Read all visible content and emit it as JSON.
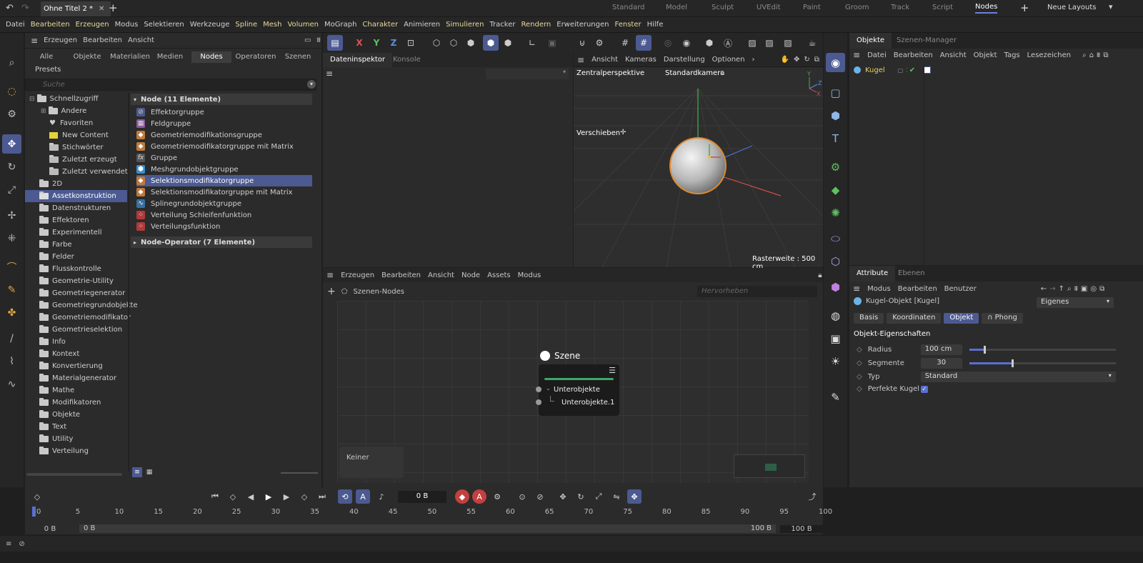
{
  "top": {
    "doc_tab": "Ohne Titel 2 *",
    "layouts": [
      "Standard",
      "Model",
      "Sculpt",
      "UVEdit",
      "Paint",
      "Groom",
      "Track",
      "Script",
      "Nodes"
    ],
    "new_layouts": "Neue Layouts"
  },
  "menu": [
    "Datei",
    "Bearbeiten",
    "Erzeugen",
    "Modus",
    "Selektieren",
    "Werkzeuge",
    "Spline",
    "Mesh",
    "Volumen",
    "MoGraph",
    "Charakter",
    "Animieren",
    "Simulieren",
    "Tracker",
    "Rendern",
    "Erweiterungen",
    "Fenster",
    "Hilfe"
  ],
  "asset": {
    "menu": [
      "Erzeugen",
      "Bearbeiten",
      "Ansicht"
    ],
    "tabs": [
      "Alle",
      "Objekte",
      "Materialien",
      "Medien",
      "Nodes",
      "Operatoren",
      "Szenen"
    ],
    "presets": "Presets",
    "search_placeholder": "Suche",
    "tree": [
      "Schnellzugriff",
      "Andere",
      "Favoriten",
      "New Content",
      "Stichwörter",
      "Zuletzt erzeugt",
      "Zuletzt verwendet",
      "2D",
      "Assetkonstruktion",
      "Datenstrukturen",
      "Effektoren",
      "Experimentell",
      "Farbe",
      "Felder",
      "Flusskontrolle",
      "Geometrie-Utility",
      "Geometriegenerator",
      "Geometriegrundobjekte",
      "Geometriemodifikator",
      "Geometrieselektion",
      "Info",
      "Kontext",
      "Konvertierung",
      "Materialgenerator",
      "Mathe",
      "Modifikatoren",
      "Objekte",
      "Text",
      "Utility",
      "Verteilung"
    ],
    "group1": "Node (11 Elemente)",
    "nodes": [
      "Effektorgruppe",
      "Feldgruppe",
      "Geometriemodifikationsgruppe",
      "Geometriemodifikatorgruppe mit Matrix",
      "Gruppe",
      "Meshgrundobjektgruppe",
      "Selektionsmodifikatorgruppe",
      "Selektionsmodifikatorgruppe mit Matrix",
      "Splinegrundobjektgruppe",
      "Verteilung Schleifenfunktion",
      "Verteilungsfunktion"
    ],
    "group2": "Node-Operator (7 Elemente)"
  },
  "inspector": {
    "tab1": "Dateninspektor",
    "tab2": "Konsole"
  },
  "viewport": {
    "menu": [
      "Ansicht",
      "Kameras",
      "Darstellung",
      "Optionen"
    ],
    "perspective": "Zentralperspektive",
    "camera": "Standardkamera",
    "tool": "Verschieben",
    "grid": "Rasterweite : 500 cm"
  },
  "nodeeditor": {
    "menu": [
      "Erzeugen",
      "Bearbeiten",
      "Ansicht",
      "Node",
      "Assets",
      "Modus"
    ],
    "path": "Szenen-Nodes",
    "search_placeholder": "Hervorheben",
    "node_title": "Szene",
    "port1": "Unterobjekte",
    "port2": "Unterobjekte.1",
    "info": "Keiner"
  },
  "objects": {
    "tab1": "Objekte",
    "tab2": "Szenen-Manager",
    "menu": [
      "Datei",
      "Bearbeiten",
      "Ansicht",
      "Objekt",
      "Tags",
      "Lesezeichen"
    ],
    "item": "Kugel"
  },
  "attributes": {
    "tab1": "Attribute",
    "tab2": "Ebenen",
    "menu": [
      "Modus",
      "Bearbeiten",
      "Benutzer"
    ],
    "object_name": "Kugel-Objekt [Kugel]",
    "dropdown": "Eigenes",
    "subtabs": [
      "Basis",
      "Koordinaten",
      "Objekt",
      "Phong"
    ],
    "section": "Objekt-Eigenschaften",
    "radius_label": "Radius",
    "radius_value": "100 cm",
    "radius_level": 0.1,
    "segments_label": "Segmente",
    "segments_value": "30",
    "segments_level": 0.29,
    "type_label": "Typ",
    "type_value": "Standard",
    "perfect_label": "Perfekte Kugel"
  },
  "timeline": {
    "frame": "0 B",
    "ticks": [
      "0",
      "5",
      "10",
      "15",
      "20",
      "25",
      "30",
      "35",
      "40",
      "45",
      "50",
      "55",
      "60",
      "65",
      "70",
      "75",
      "80",
      "85",
      "90",
      "95",
      "100"
    ],
    "start": "0 B",
    "start2": "0 B",
    "end": "100 B",
    "end2": "100 B"
  },
  "colors": {
    "accent": "#4c5a91",
    "node_green": "#3ba86a",
    "sphere_outline": "#e08a2c"
  }
}
